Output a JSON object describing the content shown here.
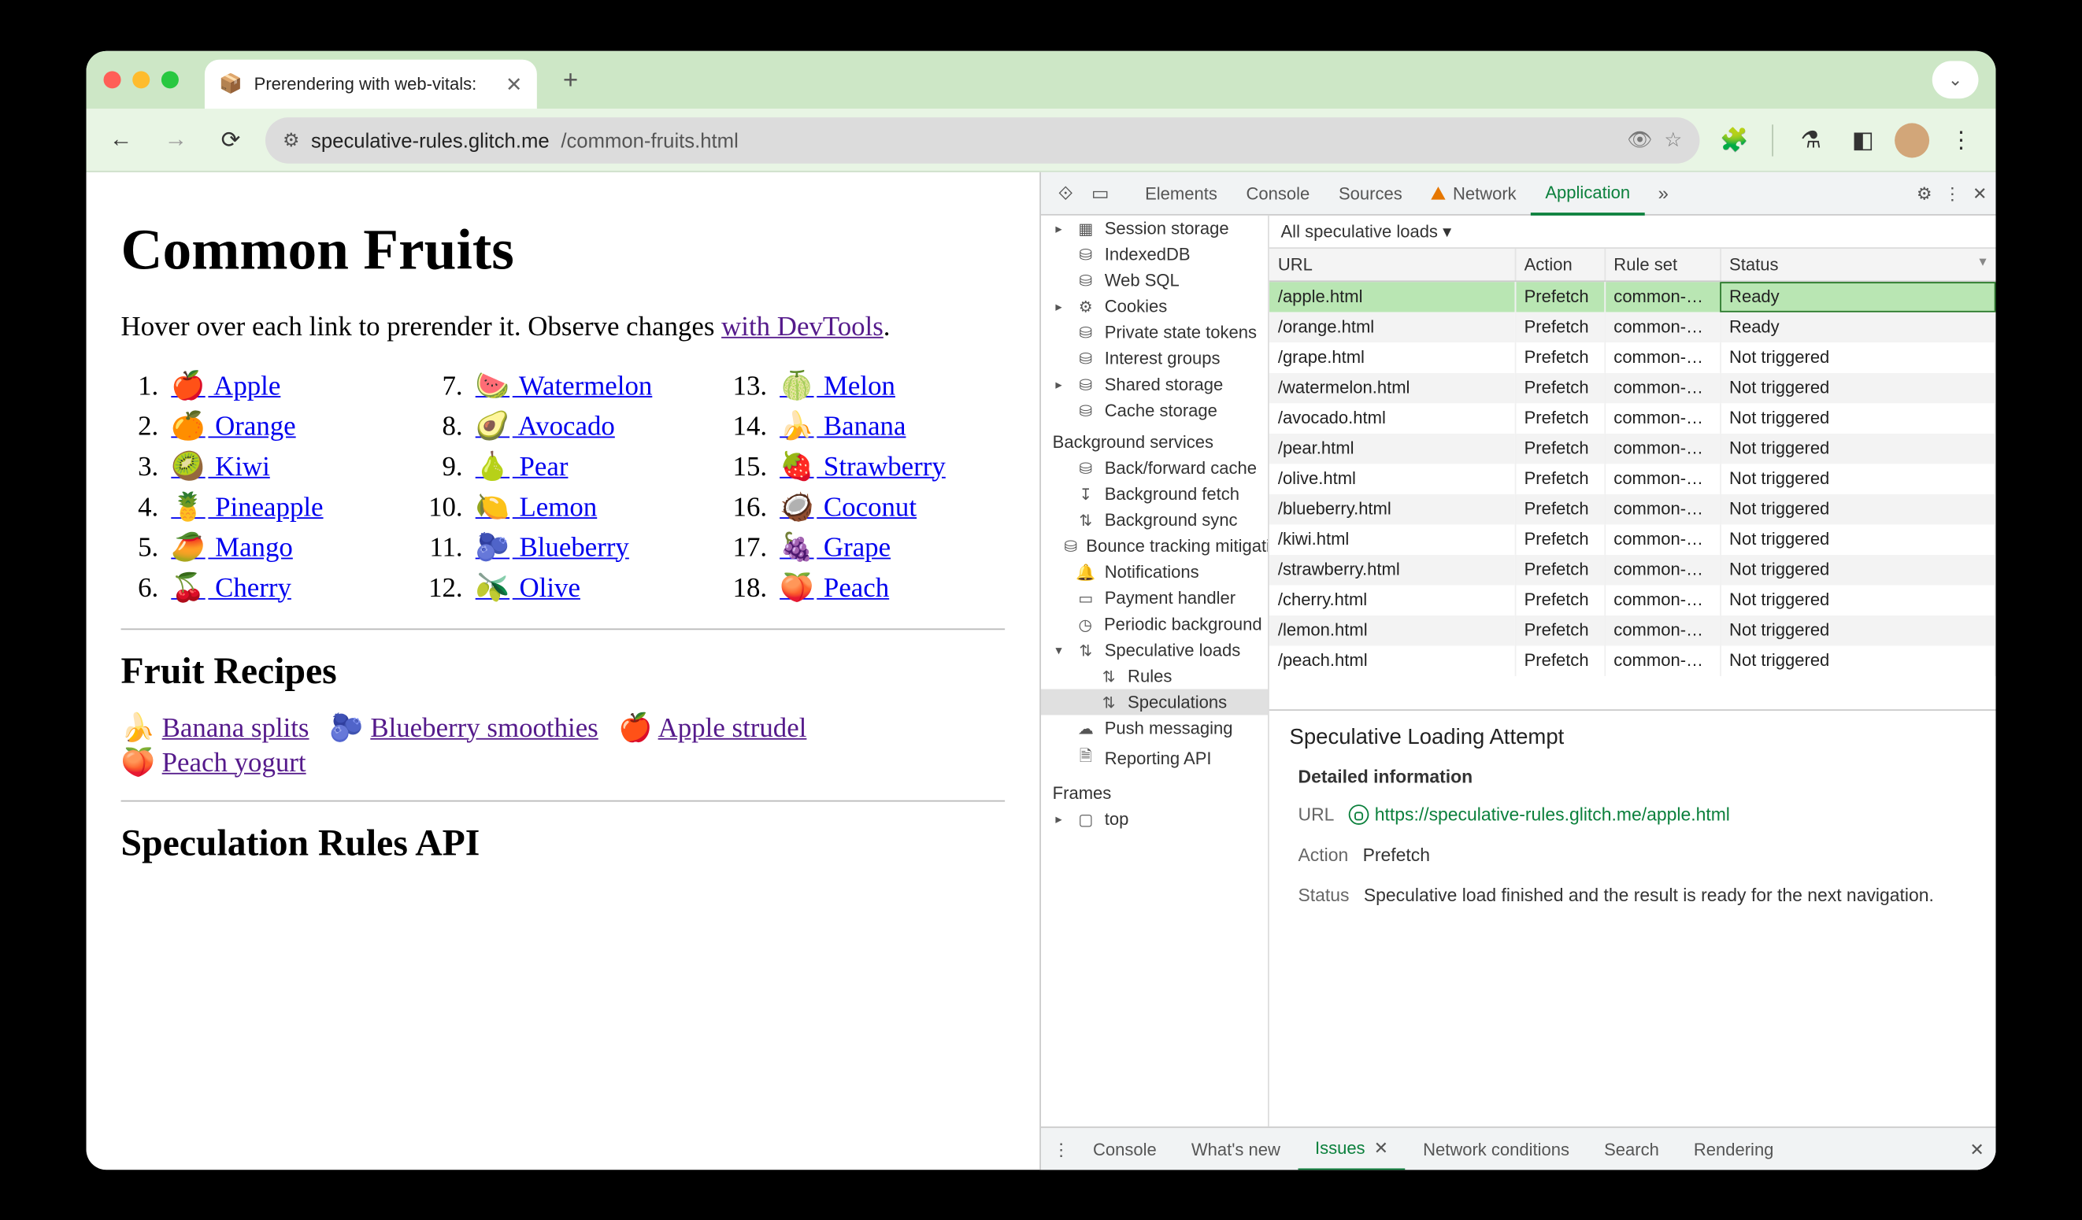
{
  "window": {
    "tab_title": "Prerendering with web-vitals:",
    "favicon": "📦"
  },
  "omnibox": {
    "host": "speculative-rules.glitch.me",
    "path": "/common-fruits.html"
  },
  "content": {
    "h1": "Common Fruits",
    "intro_pre": "Hover over each link to prerender it. Observe changes ",
    "intro_link": "with DevTools",
    "intro_post": ".",
    "fruits": [
      {
        "n": 1,
        "e": "🍎",
        "t": "Apple"
      },
      {
        "n": 2,
        "e": "🍊",
        "t": "Orange"
      },
      {
        "n": 3,
        "e": "🥝",
        "t": "Kiwi"
      },
      {
        "n": 4,
        "e": "🍍",
        "t": "Pineapple"
      },
      {
        "n": 5,
        "e": "🥭",
        "t": "Mango"
      },
      {
        "n": 6,
        "e": "🍒",
        "t": "Cherry"
      },
      {
        "n": 7,
        "e": "🍉",
        "t": "Watermelon"
      },
      {
        "n": 8,
        "e": "🥑",
        "t": "Avocado"
      },
      {
        "n": 9,
        "e": "🍐",
        "t": "Pear"
      },
      {
        "n": 10,
        "e": "🍋",
        "t": "Lemon"
      },
      {
        "n": 11,
        "e": "🫐",
        "t": "Blueberry"
      },
      {
        "n": 12,
        "e": "🫒",
        "t": "Olive"
      },
      {
        "n": 13,
        "e": "🍈",
        "t": "Melon"
      },
      {
        "n": 14,
        "e": "🍌",
        "t": "Banana"
      },
      {
        "n": 15,
        "e": "🍓",
        "t": "Strawberry"
      },
      {
        "n": 16,
        "e": "🥥",
        "t": "Coconut"
      },
      {
        "n": 17,
        "e": "🍇",
        "t": "Grape"
      },
      {
        "n": 18,
        "e": "🍑",
        "t": "Peach"
      }
    ],
    "h2_recipes": "Fruit Recipes",
    "recipes": [
      {
        "e": "🍌",
        "t": "Banana splits"
      },
      {
        "e": "🫐",
        "t": "Blueberry smoothies"
      },
      {
        "e": "🍎",
        "t": "Apple strudel"
      },
      {
        "e": "🍑",
        "t": "Peach yogurt"
      }
    ],
    "h2_api": "Speculation Rules API"
  },
  "devtools": {
    "tabs": [
      "Elements",
      "Console",
      "Sources",
      "Network",
      "Application"
    ],
    "active_tab": "Application",
    "sidebar": {
      "items": [
        {
          "tri": "▸",
          "ic": "▦",
          "label": "Session storage"
        },
        {
          "tri": "",
          "ic": "⛁",
          "label": "IndexedDB"
        },
        {
          "tri": "",
          "ic": "⛁",
          "label": "Web SQL"
        },
        {
          "tri": "▸",
          "ic": "⚙",
          "label": "Cookies"
        },
        {
          "tri": "",
          "ic": "⛁",
          "label": "Private state tokens"
        },
        {
          "tri": "",
          "ic": "⛁",
          "label": "Interest groups"
        },
        {
          "tri": "▸",
          "ic": "⛁",
          "label": "Shared storage"
        },
        {
          "tri": "",
          "ic": "⛁",
          "label": "Cache storage"
        }
      ],
      "bg_header": "Background services",
      "bg_items": [
        {
          "ic": "⛁",
          "label": "Back/forward cache"
        },
        {
          "ic": "↧",
          "label": "Background fetch"
        },
        {
          "ic": "⇅",
          "label": "Background sync"
        },
        {
          "ic": "⛁",
          "label": "Bounce tracking mitigation"
        },
        {
          "ic": "🔔",
          "label": "Notifications"
        },
        {
          "ic": "▭",
          "label": "Payment handler"
        },
        {
          "ic": "◷",
          "label": "Periodic background"
        },
        {
          "ic": "⇅",
          "label": "Speculative loads",
          "tri": "▾"
        },
        {
          "ic": "⇅",
          "label": "Rules",
          "child": true
        },
        {
          "ic": "⇅",
          "label": "Speculations",
          "child": true,
          "sel": true
        },
        {
          "ic": "☁",
          "label": "Push messaging"
        },
        {
          "ic": "🗎",
          "label": "Reporting API"
        }
      ],
      "frames_header": "Frames",
      "frame_top": "top"
    },
    "filter": "All speculative loads",
    "columns": [
      "URL",
      "Action",
      "Rule set",
      "Status"
    ],
    "rows": [
      {
        "url": "/apple.html",
        "action": "Prefetch",
        "ruleset": "common-…",
        "status": "Ready",
        "sel": true
      },
      {
        "url": "/orange.html",
        "action": "Prefetch",
        "ruleset": "common-…",
        "status": "Ready"
      },
      {
        "url": "/grape.html",
        "action": "Prefetch",
        "ruleset": "common-…",
        "status": "Not triggered"
      },
      {
        "url": "/watermelon.html",
        "action": "Prefetch",
        "ruleset": "common-…",
        "status": "Not triggered"
      },
      {
        "url": "/avocado.html",
        "action": "Prefetch",
        "ruleset": "common-…",
        "status": "Not triggered"
      },
      {
        "url": "/pear.html",
        "action": "Prefetch",
        "ruleset": "common-…",
        "status": "Not triggered"
      },
      {
        "url": "/olive.html",
        "action": "Prefetch",
        "ruleset": "common-…",
        "status": "Not triggered"
      },
      {
        "url": "/blueberry.html",
        "action": "Prefetch",
        "ruleset": "common-…",
        "status": "Not triggered"
      },
      {
        "url": "/kiwi.html",
        "action": "Prefetch",
        "ruleset": "common-…",
        "status": "Not triggered"
      },
      {
        "url": "/strawberry.html",
        "action": "Prefetch",
        "ruleset": "common-…",
        "status": "Not triggered"
      },
      {
        "url": "/cherry.html",
        "action": "Prefetch",
        "ruleset": "common-…",
        "status": "Not triggered"
      },
      {
        "url": "/lemon.html",
        "action": "Prefetch",
        "ruleset": "common-…",
        "status": "Not triggered"
      },
      {
        "url": "/peach.html",
        "action": "Prefetch",
        "ruleset": "common-…",
        "status": "Not triggered"
      }
    ],
    "detail": {
      "title": "Speculative Loading Attempt",
      "section": "Detailed information",
      "url_label": "URL",
      "url_value": "https://speculative-rules.glitch.me/apple.html",
      "action_label": "Action",
      "action_value": "Prefetch",
      "status_label": "Status",
      "status_value": "Speculative load finished and the result is ready for the next navigation."
    },
    "drawer": [
      "Console",
      "What's new",
      "Issues",
      "Network conditions",
      "Search",
      "Rendering"
    ],
    "drawer_active": "Issues"
  }
}
